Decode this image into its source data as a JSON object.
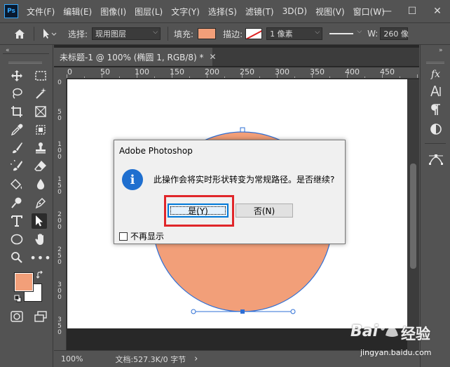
{
  "menubar": {
    "logo": "Ps",
    "items": [
      "文件(F)",
      "编辑(E)",
      "图像(I)",
      "图层(L)",
      "文字(Y)",
      "选择(S)",
      "滤镜(T)",
      "3D(D)",
      "视图(V)",
      "窗口(W)"
    ],
    "window_buttons": [
      "—",
      "☐",
      "✕"
    ]
  },
  "options": {
    "select_label": "选择:",
    "select_value": "现用图层",
    "fill_label": "填充:",
    "stroke_label": "描边:",
    "stroke_width": "1 像素",
    "w_label": "W:",
    "w_value": "260 像"
  },
  "document": {
    "tab_title": "未标题-1 @ 100% (椭圆 1, RGB/8) *",
    "tab_close": "✕",
    "ruler_h": [
      "0",
      "50",
      "100",
      "150",
      "200",
      "250",
      "300",
      "350",
      "400",
      "450"
    ],
    "ruler_v": [
      "0",
      "5\n0",
      "1\n0\n0",
      "1\n5\n0",
      "2\n0\n0",
      "2\n5\n0",
      "3\n0\n0",
      "3\n5\n0"
    ]
  },
  "status": {
    "zoom": "100%",
    "doc_info": "文档:527.3K/0 字节",
    "arrow": "›"
  },
  "dialog": {
    "title": "Adobe Photoshop",
    "message": "此操作会将实时形状转变为常规路径。是否继续?",
    "icon": "i",
    "yes_label": "是(Y)",
    "no_label": "否(N)",
    "checkbox_label": "不再显示"
  },
  "right_panel": {
    "fx": "fx"
  },
  "colors": {
    "foreground": "#f29f79",
    "background": "#ffffff",
    "shape_fill": "#f29f79",
    "path_stroke": "#2e6fd6",
    "highlight": "#e0262a"
  },
  "watermark": {
    "brand": "Bai",
    "brand2": "经验",
    "url": "jingyan.baidu.com"
  }
}
